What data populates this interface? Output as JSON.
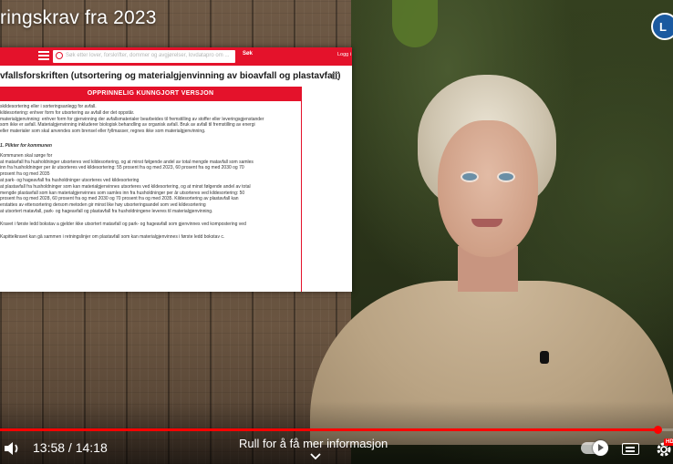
{
  "video": {
    "title": "ringskrav fra 2023",
    "channel_badge_letter": "L",
    "current_time": "13:58",
    "duration": "14:18",
    "time_separator": " / ",
    "progress_fraction": 0.977,
    "more_info_label": "Rull for å få mer informasjon",
    "hd_label": "HD"
  },
  "site": {
    "search_placeholder": "Søk etter lover, forskrifter, dommer og avgjørelser, lovdatapro om ...",
    "search_button": "Søk",
    "login_label": "Logg i",
    "heading": "vfallsforskriften (utsortering og materialgjenvinning av bioavfall og plastavfall)",
    "panel_title": "OPPRINNELIG KUNNGJORT VERSJON",
    "lines_intro": [
      "skildesortering eller i sorteringsanlegg for avfall.",
      "kildesortering: enhver form for utsortering av avfall der det oppstår.",
      "materialgjenvinning: enhver form for gjenvinning der avfallsmaterialer bearbeides til fremstilling av stoffer eller leveringsgjenstander",
      "som ikke er avfall. Materialgjenvinning inkluderer biologisk behandling av organisk avfall. Bruk av avfall til fremstilling av energi",
      "eller materialer som skal anvendes som brensel eller fyllmasser, regnes ikke som materialgjenvinning."
    ],
    "section_title": "1. Plikter for kommunen",
    "lines_body": [
      "Kommunen skal sørge for",
      "at matavfall fra husholdninger utsorteres ved kildesortering, og at minst følgende andel av total mengde matavfall som samles",
      "inn fra husholdninger per år utsorteres ved kildesortering: 55 prosent fra og med 2023, 60 prosent fra og med 2030 og 70",
      "prosent fra og med 2035",
      "at park- og hageavfall fra husholdninger utsorteres ved kildesortering",
      "at plastavfall fra husholdninger som kan materialgjenvinnes utsorteres ved kildesortering, og at minst følgende andel av total",
      "mengde plastavfall som kan materialgjenvinnes som samles inn fra husholdninger per år utsorteres ved kildesortering: 50",
      "prosent fra og med 2028, 60 prosent fra og med 2030 og 70 prosent fra og med 2035. Kildesortering av plastavfall kan",
      "erstattes av ettersortering dersom metoden gir minst like høy utsorteringsandel som ved kildesortering",
      "at utsortert matavfall, park- og hageavfall og plastavfall fra husholdningene leveres til materialgjenvinning."
    ],
    "lines_tail": [
      "Kravet i første ledd bokstav a gjelder ikke utsortert matavfall og park- og hageavfall som gjenvinnes ved kompostering ved",
      "Kapittelkravet kan gå sammen i retningslinjer om plastavfall som kan materialgjenvinnes i første ledd bokstav c."
    ]
  },
  "colors": {
    "brand_red": "#e4122b",
    "progress_red": "#ff0000"
  },
  "icons": [
    "menu-icon",
    "search-icon",
    "print-icon",
    "volume-icon",
    "chevron-down-icon",
    "autoplay-toggle",
    "subtitles-icon",
    "gear-icon"
  ]
}
